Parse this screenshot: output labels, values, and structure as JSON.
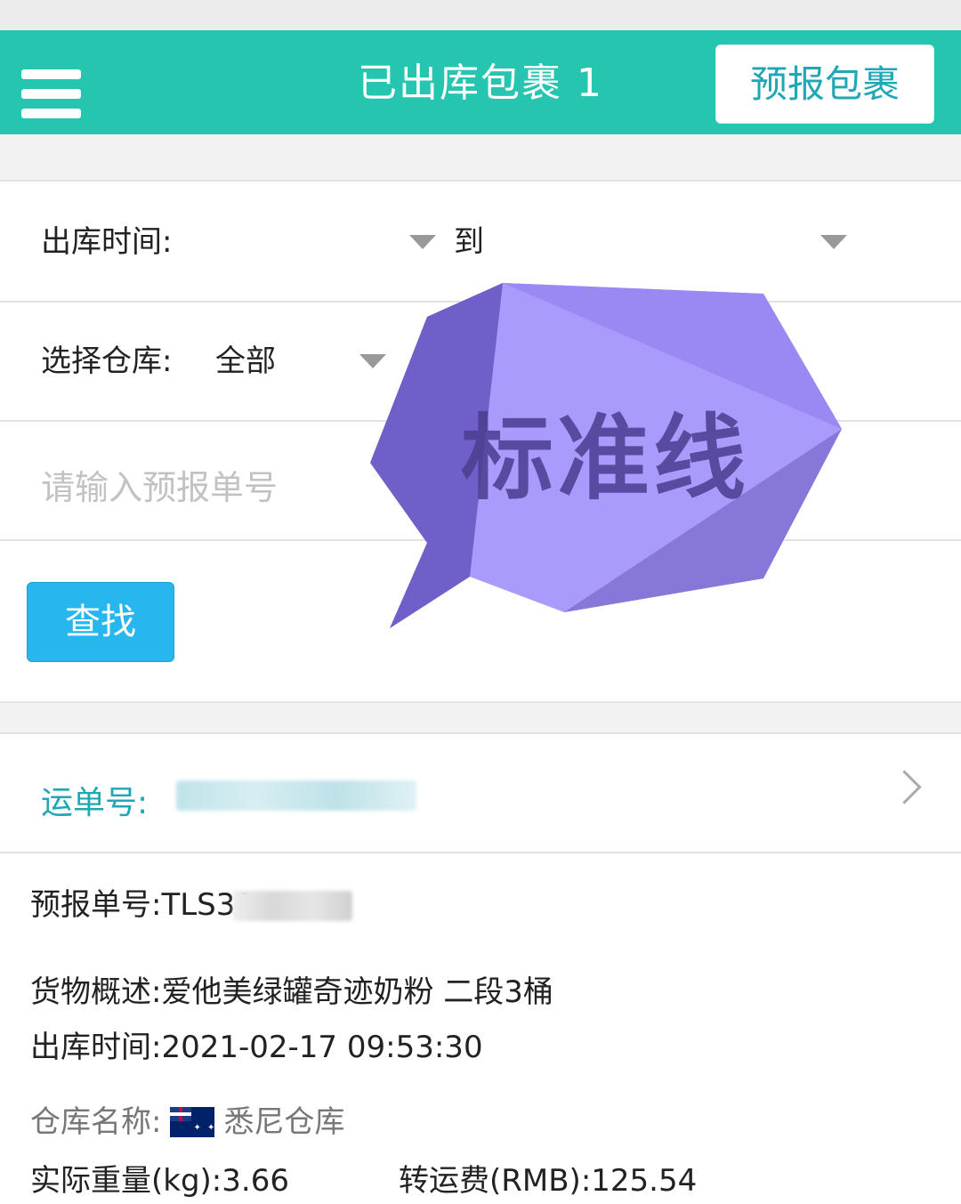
{
  "header": {
    "title": "已出库包裹 1",
    "predeclare_button": "预报包裹"
  },
  "filters": {
    "out_time_label": "出库时间:",
    "to_label": "到",
    "warehouse_label": "选择仓库:",
    "warehouse_value": "全部",
    "predeclare_no_placeholder": "请输入预报单号",
    "search_button": "查找"
  },
  "badge": {
    "text": "标准线",
    "color": "#a99bfb"
  },
  "result": {
    "waybill_label": "运单号:",
    "predeclare_no_label": "预报单号:",
    "predeclare_no_value": "TLS31",
    "description_label": "货物概述:",
    "description_value": "爱他美绿罐奇迹奶粉 二段3桶",
    "out_time_label": "出库时间:",
    "out_time_value": "2021-02-17 09:53:30",
    "warehouse_name_label": "仓库名称:",
    "warehouse_flag_icon": "australia-flag-icon",
    "warehouse_name_value": "悉尼仓库",
    "weight_label": "实际重量(kg):",
    "weight_value": "3.66",
    "fee_label": "转运费(RMB):",
    "fee_value": "125.54"
  },
  "colors": {
    "header_bg": "#26c5b0",
    "accent_text": "#1fa7b5",
    "search_button_bg": "#27b7ee"
  }
}
